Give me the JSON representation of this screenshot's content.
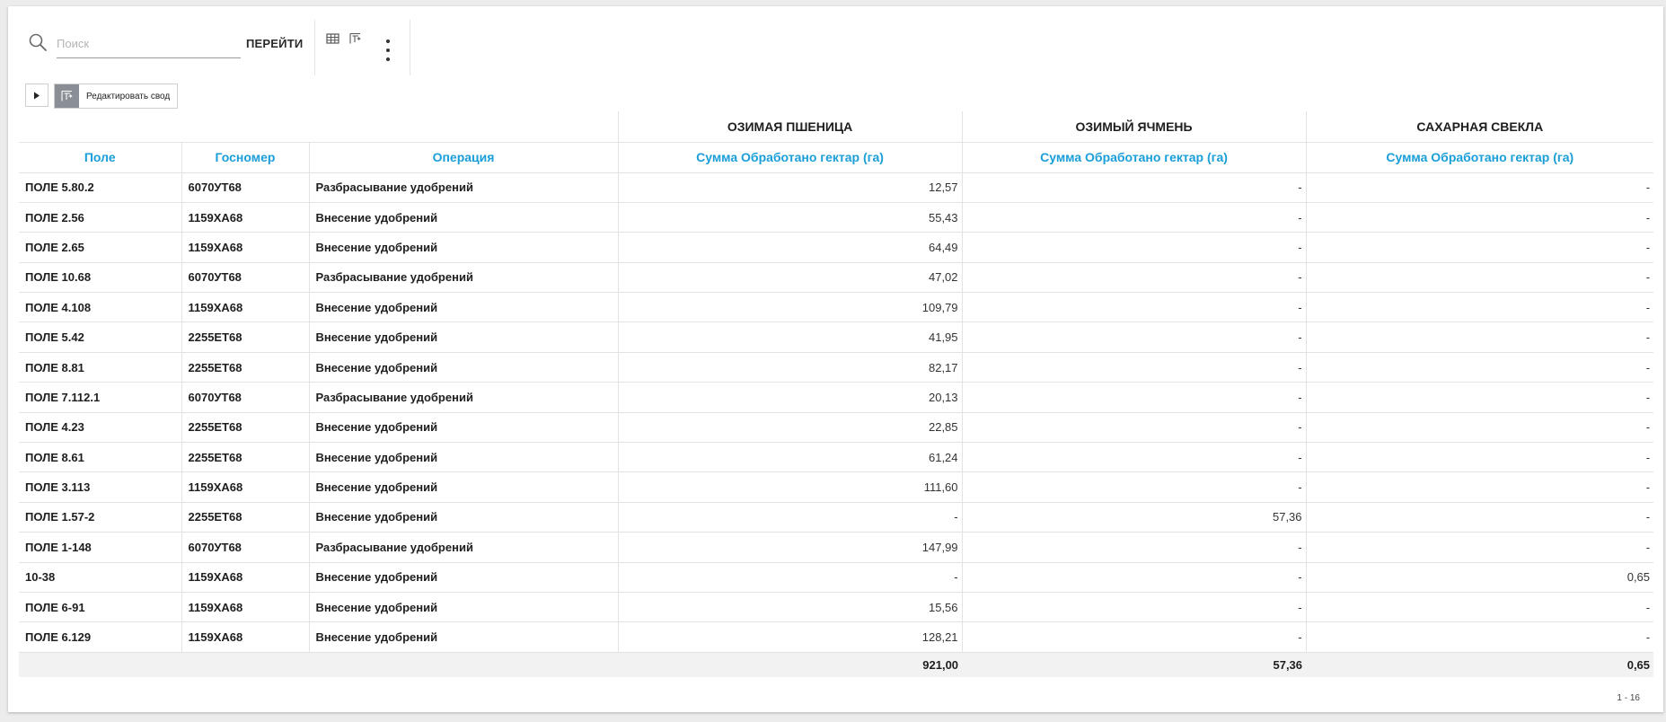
{
  "toolbar": {
    "search_placeholder": "Поиск",
    "search_value": "",
    "go_label": "ПЕРЕЙТИ"
  },
  "pivot_bar": {
    "edit_label": "Редактировать свод"
  },
  "table": {
    "row_headers": [
      "Поле",
      "Госномер",
      "Операция"
    ],
    "crops": [
      "ОЗИМАЯ ПШЕНИЦА",
      "ОЗИМЫЙ ЯЧМЕНЬ",
      "САХАРНАЯ СВЕКЛА"
    ],
    "measure_label": "Сумма Обработано гектар (га)",
    "rows": [
      {
        "field": "ПОЛЕ 5.80.2",
        "plate": "6070УТ68",
        "operation": "Разбрасывание удобрений",
        "wheat": "12,57",
        "barley": "-",
        "beet": "-"
      },
      {
        "field": "ПОЛЕ 2.56",
        "plate": "1159ХА68",
        "operation": "Внесение удобрений",
        "wheat": "55,43",
        "barley": "-",
        "beet": "-"
      },
      {
        "field": "ПОЛЕ 2.65",
        "plate": "1159ХА68",
        "operation": "Внесение удобрений",
        "wheat": "64,49",
        "barley": "-",
        "beet": "-"
      },
      {
        "field": "ПОЛЕ 10.68",
        "plate": "6070УТ68",
        "operation": "Разбрасывание удобрений",
        "wheat": "47,02",
        "barley": "-",
        "beet": "-"
      },
      {
        "field": "ПОЛЕ 4.108",
        "plate": "1159ХА68",
        "operation": "Внесение удобрений",
        "wheat": "109,79",
        "barley": "-",
        "beet": "-"
      },
      {
        "field": "ПОЛЕ 5.42",
        "plate": "2255ЕТ68",
        "operation": "Внесение удобрений",
        "wheat": "41,95",
        "barley": "-",
        "beet": "-"
      },
      {
        "field": "ПОЛЕ 8.81",
        "plate": "2255ЕТ68",
        "operation": "Внесение удобрений",
        "wheat": "82,17",
        "barley": "-",
        "beet": "-"
      },
      {
        "field": "ПОЛЕ 7.112.1",
        "plate": "6070УТ68",
        "operation": "Разбрасывание удобрений",
        "wheat": "20,13",
        "barley": "-",
        "beet": "-"
      },
      {
        "field": "ПОЛЕ 4.23",
        "plate": "2255ЕТ68",
        "operation": "Внесение удобрений",
        "wheat": "22,85",
        "barley": "-",
        "beet": "-"
      },
      {
        "field": "ПОЛЕ 8.61",
        "plate": "2255ЕТ68",
        "operation": "Внесение удобрений",
        "wheat": "61,24",
        "barley": "-",
        "beet": "-"
      },
      {
        "field": "ПОЛЕ 3.113",
        "plate": "1159ХА68",
        "operation": "Внесение удобрений",
        "wheat": "111,60",
        "barley": "-",
        "beet": "-"
      },
      {
        "field": "ПОЛЕ 1.57-2",
        "plate": "2255ЕТ68",
        "operation": "Внесение удобрений",
        "wheat": "-",
        "barley": "57,36",
        "beet": "-"
      },
      {
        "field": "ПОЛЕ 1-148",
        "plate": "6070УТ68",
        "operation": "Разбрасывание удобрений",
        "wheat": "147,99",
        "barley": "-",
        "beet": "-"
      },
      {
        "field": "10-38",
        "plate": "1159ХА68",
        "operation": "Внесение удобрений",
        "wheat": "-",
        "barley": "-",
        "beet": "0,65"
      },
      {
        "field": "ПОЛЕ 6-91",
        "plate": "1159ХА68",
        "operation": "Внесение удобрений",
        "wheat": "15,56",
        "barley": "-",
        "beet": "-"
      },
      {
        "field": "ПОЛЕ 6.129",
        "plate": "1159ХА68",
        "operation": "Внесение удобрений",
        "wheat": "128,21",
        "barley": "-",
        "beet": "-"
      }
    ],
    "totals": {
      "wheat": "921,00",
      "barley": "57,36",
      "beet": "0,65"
    }
  },
  "pager": {
    "range": "1 - 16"
  },
  "colors": {
    "accent": "#1a9ed9",
    "total_bg": "#f2f2f2",
    "border": "#e3e3e3"
  },
  "icons": [
    "search-icon",
    "table-view-icon",
    "pivot-view-icon",
    "more-vertical-icon",
    "play-icon",
    "pivot-edit-icon"
  ]
}
